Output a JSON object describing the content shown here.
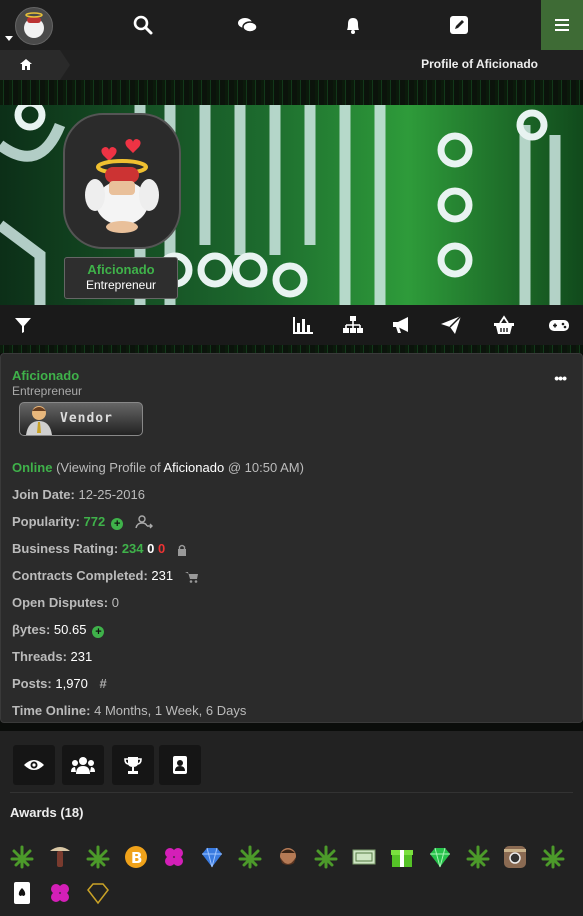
{
  "breadcrumb": {
    "title": "Profile of Aficionado"
  },
  "profile": {
    "username": "Aficionado",
    "role": "Entrepreneur",
    "badge_text": "Vendor"
  },
  "stats": {
    "status": "Online",
    "viewing_open": " (Viewing Profile of ",
    "viewing_user": "Aficionado",
    "viewing_close": " @ 10:50 AM)",
    "join_label": "Join Date:",
    "join_value": "12-25-2016",
    "popularity_label": "Popularity:",
    "popularity_value": "772",
    "business_label": "Business Rating:",
    "business_pos": "234",
    "business_neutral": "0",
    "business_neg": "0",
    "contracts_label": "Contracts Completed:",
    "contracts_value": "231",
    "disputes_label": "Open Disputes:",
    "disputes_value": "0",
    "bytes_label": "βytes:",
    "bytes_value": "50.65",
    "threads_label": "Threads:",
    "threads_value": "231",
    "posts_label": "Posts:",
    "posts_value": "1,970",
    "time_label": "Time Online:",
    "time_value": "4 Months, 1 Week, 6 Days"
  },
  "awards": {
    "title": "Awards (18)",
    "icons": [
      "leaf-icon",
      "mushroom-icon",
      "leaf-icon",
      "bitcoin-icon",
      "clover-icon",
      "diamond-icon",
      "leaf-icon",
      "bearded-man-icon",
      "leaf-icon",
      "cash-icon",
      "gift-icon",
      "emerald-icon",
      "leaf-icon",
      "camera-icon",
      "leaf-icon",
      "ace-card-icon",
      "clover-icon",
      "onyx-icon"
    ]
  },
  "colors": {
    "accent_green": "#3fb24a",
    "negative_red": "#e33",
    "menu_green": "#3e6b35"
  }
}
